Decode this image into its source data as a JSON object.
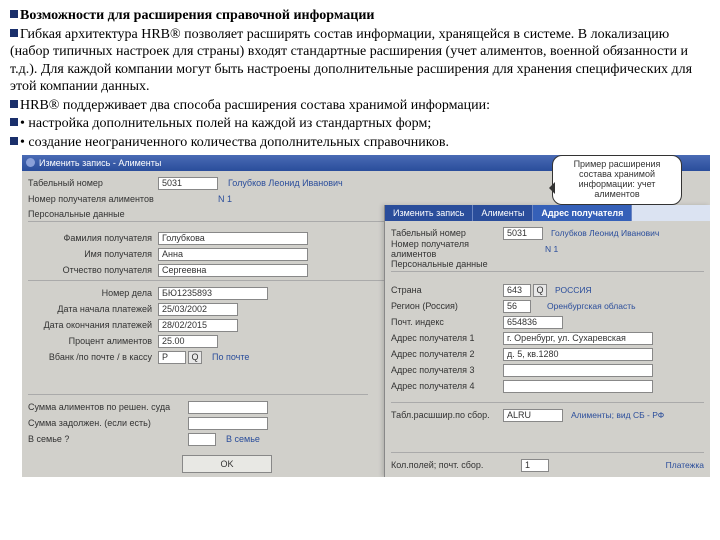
{
  "text": {
    "h1": "Возможности для расширения справочной информации",
    "p1": "Гибкая архитектура HRB® позволяет расширять состав информации, хранящейся в системе. В локализацию (набор типичных настроек для страны) входят стандартные расширения (учет алиментов, военной обязанности и т.д.). Для каждой компании могут быть настроены дополнительные расширения для хранения специфических для этой компании данных.",
    "p2": "HRB® поддерживает два способа расширения состава хранимой информации:",
    "p3": "• настройка дополнительных полей на каждой из стандартных форм;",
    "p4": "• создание неограниченного количества дополнительных справочников."
  },
  "callout": "Пример расширения состава хранимой информации: учет алиментов",
  "win1": {
    "title": "Изменить запись - Алименты",
    "tabnum_l": "Табельный номер",
    "tabnum_v": "5031",
    "tabnum_name": "Голубков Леонид Иванович",
    "recnum_l": "Номер получателя алиментов",
    "recnum_v": "N 1",
    "pers_l": "Персональные данные",
    "fam_l": "Фамилия получателя",
    "fam_v": "Голубкова",
    "imya_l": "Имя получателя",
    "imya_v": "Анна",
    "otch_l": "Отчество получателя",
    "otch_v": "Сергеевна",
    "delo_l": "Номер дела",
    "delo_v": "БЮ1235893",
    "dstart_l": "Дата начала платежей",
    "dstart_v": "25/03/2002",
    "dend_l": "Дата окончания платежей",
    "dend_v": "28/02/2015",
    "pct_l": "Процент алиментов",
    "pct_v": "25.00",
    "bank_l": "Вбанк /по почте / в кассу",
    "bank_v": "P",
    "bank_link": "По почте",
    "sum1_l": "Сумма алиментов по решен. суда",
    "sum2_l": "Сумма задолжен. (если есть)",
    "fam2_l": "В семье ?",
    "fam2_link": "В семье",
    "ok": "OK"
  },
  "win2": {
    "tab1": "Изменить запись",
    "tab2": "Алименты",
    "tab3": "Адрес получателя",
    "tabnum_l": "Табельный номер",
    "tabnum_v": "5031",
    "tabnum_name": "Голубков Леонид Иванович",
    "recnum_l": "Номер получателя алиментов",
    "recnum_v": "N 1",
    "pers_l": "Персональные данные",
    "country_l": "Страна",
    "country_v": "643",
    "country_link": "РОССИЯ",
    "region_l": "Регион (Россия)",
    "region_v": "56",
    "region_link": "Оренбургская область",
    "zip_l": "Почт. индекс",
    "zip_v": "654836",
    "a1_l": "Адрес получателя 1",
    "a1_v": "г. Оренбург, ул. Сухаревская",
    "a2_l": "Адрес получателя 2",
    "a2_v": "д. 5, кв.1280",
    "a3_l": "Адрес получателя 3",
    "a4_l": "Адрес получателя 4",
    "tbl_l": "Табл.расшшир.по сбор.",
    "tbl_v": "ALRU",
    "tbl_r": "Алименты; вид СБ - РФ",
    "foot_l": "Кол.полей; почт. сбор.",
    "foot_v": "1",
    "foot_r": "Платежка"
  }
}
